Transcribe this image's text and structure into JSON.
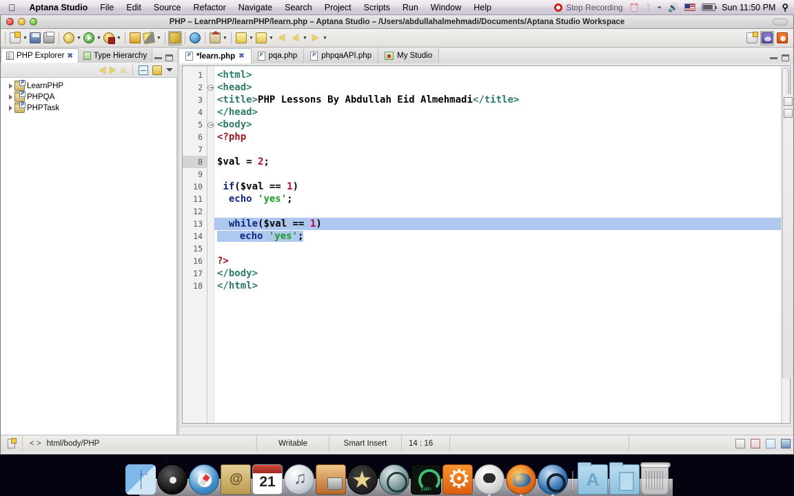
{
  "menubar": {
    "apple_icon": "apple-logo-icon",
    "app_name": "Aptana Studio",
    "items": [
      "File",
      "Edit",
      "Source",
      "Refactor",
      "Navigate",
      "Search",
      "Project",
      "Scripts",
      "Run",
      "Window",
      "Help"
    ],
    "recording_label": "Stop Recording",
    "status_icons": [
      "timemachine-icon",
      "bluetooth-icon",
      "wifi-icon",
      "volume-icon",
      "us-flag-icon",
      "battery-icon"
    ],
    "clock": "Sun 11:50 PM",
    "spotlight_icon": "search-icon"
  },
  "window": {
    "title": "PHP – LearnPHP/learnPHP/learn.php – Aptana Studio – /Users/abdullahalmehmadi/Documents/Aptana Studio Workspace",
    "traffic_lights": [
      "close-button",
      "minimize-button",
      "zoom-button"
    ]
  },
  "toolbar": {
    "groups": [
      {
        "buttons": [
          {
            "name": "new-file-button",
            "icon": "new-file-icon",
            "dropdown": true
          },
          {
            "name": "save-button",
            "icon": "save-icon",
            "dropdown": false
          },
          {
            "name": "print-button",
            "icon": "print-icon",
            "dropdown": false
          }
        ]
      },
      {
        "buttons": [
          {
            "name": "debug-button",
            "icon": "debug-bug-icon",
            "dropdown": true
          },
          {
            "name": "run-button",
            "icon": "run-play-icon",
            "dropdown": true
          },
          {
            "name": "profile-button",
            "icon": "profile-icon",
            "dropdown": true
          }
        ]
      },
      {
        "buttons": [
          {
            "name": "open-folder-button",
            "icon": "open-folder-icon",
            "dropdown": false
          },
          {
            "name": "external-tools-button",
            "icon": "wrench-icon",
            "dropdown": true
          }
        ]
      },
      {
        "buttons": [
          {
            "name": "preview-button",
            "icon": "paint-brush-icon",
            "dropdown": false,
            "selected": true
          }
        ]
      },
      {
        "buttons": [
          {
            "name": "open-browser-button",
            "icon": "globe-icon",
            "dropdown": false
          }
        ]
      },
      {
        "buttons": [
          {
            "name": "home-button",
            "icon": "home-icon",
            "dropdown": true
          }
        ]
      },
      {
        "buttons": [
          {
            "name": "next-annotation-button",
            "icon": "down-arrow-icon",
            "dropdown": true
          },
          {
            "name": "prev-annotation-button",
            "icon": "up-arrow-icon",
            "dropdown": true
          }
        ]
      },
      {
        "buttons": [
          {
            "name": "back-history-button",
            "icon": "back-arrow-icon",
            "dropdown": false
          },
          {
            "name": "backward-button",
            "icon": "back-arrow-icon",
            "dropdown": true
          },
          {
            "name": "forward-button",
            "icon": "forward-arrow-icon",
            "dropdown": true
          }
        ]
      }
    ],
    "perspectives": [
      {
        "name": "open-perspective-button",
        "icon": "open-perspective-icon"
      },
      {
        "name": "perspective-php-button",
        "icon": "php-perspective-icon",
        "selected": true
      },
      {
        "name": "perspective-studio-button",
        "icon": "studio-perspective-icon"
      }
    ]
  },
  "left_panel": {
    "tabs": [
      {
        "label": "PHP Explorer",
        "icon": "explorer-icon",
        "active": true,
        "closeable": true
      },
      {
        "label": "Type Hierarchy",
        "icon": "hierarchy-icon",
        "active": false,
        "closeable": false
      }
    ],
    "panel_controls": [
      "minimize-view-button",
      "maximize-view-button"
    ],
    "view_toolbar": [
      {
        "name": "back-button",
        "icon": "back-arrow-icon"
      },
      {
        "name": "forward-button",
        "icon": "forward-arrow-icon"
      },
      {
        "name": "up-button",
        "icon": "up-folder-icon"
      },
      {
        "name": "collapse-all-button",
        "icon": "collapse-all-icon"
      },
      {
        "name": "link-with-editor-button",
        "icon": "link-editor-icon"
      },
      {
        "name": "view-menu-button",
        "icon": "chevron-down-icon"
      }
    ],
    "tree": [
      {
        "label": "LearnPHP",
        "icon": "php-project-icon",
        "expanded": false
      },
      {
        "label": "PHPQA",
        "icon": "php-project-icon",
        "expanded": false
      },
      {
        "label": "PHPTask",
        "icon": "php-project-icon",
        "expanded": false
      }
    ]
  },
  "editor": {
    "tabs": [
      {
        "label": "*learn.php",
        "icon": "php-file-icon",
        "active": true,
        "dirty": true,
        "closeable": true
      },
      {
        "label": "pqa.php",
        "icon": "php-file-icon",
        "active": false,
        "dirty": false,
        "closeable": false
      },
      {
        "label": "phpqaAPI.php",
        "icon": "php-file-icon",
        "active": false,
        "dirty": false,
        "closeable": false
      },
      {
        "label": "My Studio",
        "icon": "studio-icon",
        "active": false,
        "dirty": false,
        "closeable": false
      }
    ],
    "tab_controls": [
      "minimize-editor-button",
      "maximize-editor-button"
    ],
    "current_line": 8,
    "selection_lines": [
      13,
      14
    ],
    "lines": [
      {
        "n": 1,
        "fold": false,
        "tokens": [
          {
            "t": "<html>",
            "c": "tag"
          }
        ]
      },
      {
        "n": 2,
        "fold": true,
        "tokens": [
          {
            "t": "<head>",
            "c": "tag"
          }
        ]
      },
      {
        "n": 3,
        "fold": false,
        "tokens": [
          {
            "t": "<title>",
            "c": "tag"
          },
          {
            "t": "PHP Lessons By Abdullah Eid Almehmadi",
            "c": "plain"
          },
          {
            "t": "</title>",
            "c": "tag"
          }
        ]
      },
      {
        "n": 4,
        "fold": false,
        "tokens": [
          {
            "t": "</head>",
            "c": "tag"
          }
        ]
      },
      {
        "n": 5,
        "fold": true,
        "tokens": [
          {
            "t": "<body>",
            "c": "tag"
          }
        ]
      },
      {
        "n": 6,
        "fold": false,
        "tokens": [
          {
            "t": "<?php",
            "c": "php"
          }
        ]
      },
      {
        "n": 7,
        "fold": false,
        "tokens": []
      },
      {
        "n": 8,
        "fold": false,
        "tokens": [
          {
            "t": "$val = ",
            "c": "plain"
          },
          {
            "t": "2",
            "c": "num"
          },
          {
            "t": ";",
            "c": "plain"
          }
        ]
      },
      {
        "n": 9,
        "fold": false,
        "tokens": []
      },
      {
        "n": 10,
        "fold": false,
        "tokens": [
          {
            "t": " ",
            "c": "plain"
          },
          {
            "t": "if",
            "c": "kw"
          },
          {
            "t": "($val == ",
            "c": "plain"
          },
          {
            "t": "1",
            "c": "num"
          },
          {
            "t": ")",
            "c": "plain"
          }
        ]
      },
      {
        "n": 11,
        "fold": false,
        "tokens": [
          {
            "t": "  ",
            "c": "plain"
          },
          {
            "t": "echo",
            "c": "kw"
          },
          {
            "t": " ",
            "c": "plain"
          },
          {
            "t": "'yes'",
            "c": "str"
          },
          {
            "t": ";",
            "c": "plain"
          }
        ]
      },
      {
        "n": 12,
        "fold": false,
        "tokens": []
      },
      {
        "n": 13,
        "fold": false,
        "tokens": [
          {
            "t": "  ",
            "c": "plain"
          },
          {
            "t": "while",
            "c": "kw"
          },
          {
            "t": "($val == ",
            "c": "plain"
          },
          {
            "t": "1",
            "c": "num"
          },
          {
            "t": ")",
            "c": "plain"
          }
        ]
      },
      {
        "n": 14,
        "fold": false,
        "tokens": [
          {
            "t": "    ",
            "c": "plain"
          },
          {
            "t": "echo",
            "c": "kw"
          },
          {
            "t": " ",
            "c": "plain"
          },
          {
            "t": "'yes'",
            "c": "str"
          },
          {
            "t": ";",
            "c": "plain"
          }
        ]
      },
      {
        "n": 15,
        "fold": false,
        "tokens": []
      },
      {
        "n": 16,
        "fold": false,
        "tokens": [
          {
            "t": "?>",
            "c": "php"
          }
        ]
      },
      {
        "n": 17,
        "fold": false,
        "tokens": [
          {
            "t": "</body>",
            "c": "tag"
          }
        ]
      },
      {
        "n": 18,
        "fold": false,
        "tokens": [
          {
            "t": "</html>",
            "c": "tag"
          }
        ]
      }
    ],
    "colors": {
      "tag": "#2f7b6b",
      "keyword": "#12277e",
      "number": "#b5003c",
      "string": "#1b9a26",
      "php_delimiter": "#99131a",
      "selection": "#aec8f0",
      "current_line_gutter": "#d4d4d4"
    }
  },
  "statusbar": {
    "icon": "new-resource-icon",
    "breadcrumb_prefix": "< >",
    "breadcrumb": "html/body/PHP",
    "writable": "Writable",
    "insert_mode": "Smart Insert",
    "cursor_position": "14 : 16",
    "right_icons": [
      "panel-icon",
      "annotation-icon",
      "tasks-icon",
      "console-icon"
    ]
  },
  "dock": {
    "items": [
      {
        "name": "finder",
        "icon": "finder-icon",
        "running": true
      },
      {
        "name": "dashboard",
        "icon": "dashboard-icon",
        "running": false
      },
      {
        "name": "safari",
        "icon": "safari-icon",
        "running": false
      },
      {
        "name": "address-book",
        "icon": "address-book-icon",
        "running": false
      },
      {
        "name": "ical",
        "icon": "calendar-icon",
        "running": false,
        "badge": "21"
      },
      {
        "name": "itunes",
        "icon": "itunes-icon",
        "running": false
      },
      {
        "name": "iphoto",
        "icon": "iphoto-icon",
        "running": false
      },
      {
        "name": "imovie",
        "icon": "imovie-icon",
        "running": false
      },
      {
        "name": "time-machine",
        "icon": "time-machine-icon",
        "running": false
      },
      {
        "name": "zain",
        "icon": "zain-icon",
        "running": false
      },
      {
        "name": "system-preferences",
        "icon": "system-preferences-icon",
        "running": false
      },
      {
        "name": "ichat",
        "icon": "ichat-icon",
        "running": true
      },
      {
        "name": "firefox",
        "icon": "firefox-icon",
        "running": true
      },
      {
        "name": "quicktime",
        "icon": "quicktime-icon",
        "running": true
      },
      {
        "name": "applications-folder",
        "icon": "applications-folder-icon",
        "running": false
      },
      {
        "name": "documents-folder",
        "icon": "documents-folder-icon",
        "running": false
      },
      {
        "name": "trash",
        "icon": "trash-icon",
        "running": false
      }
    ]
  }
}
